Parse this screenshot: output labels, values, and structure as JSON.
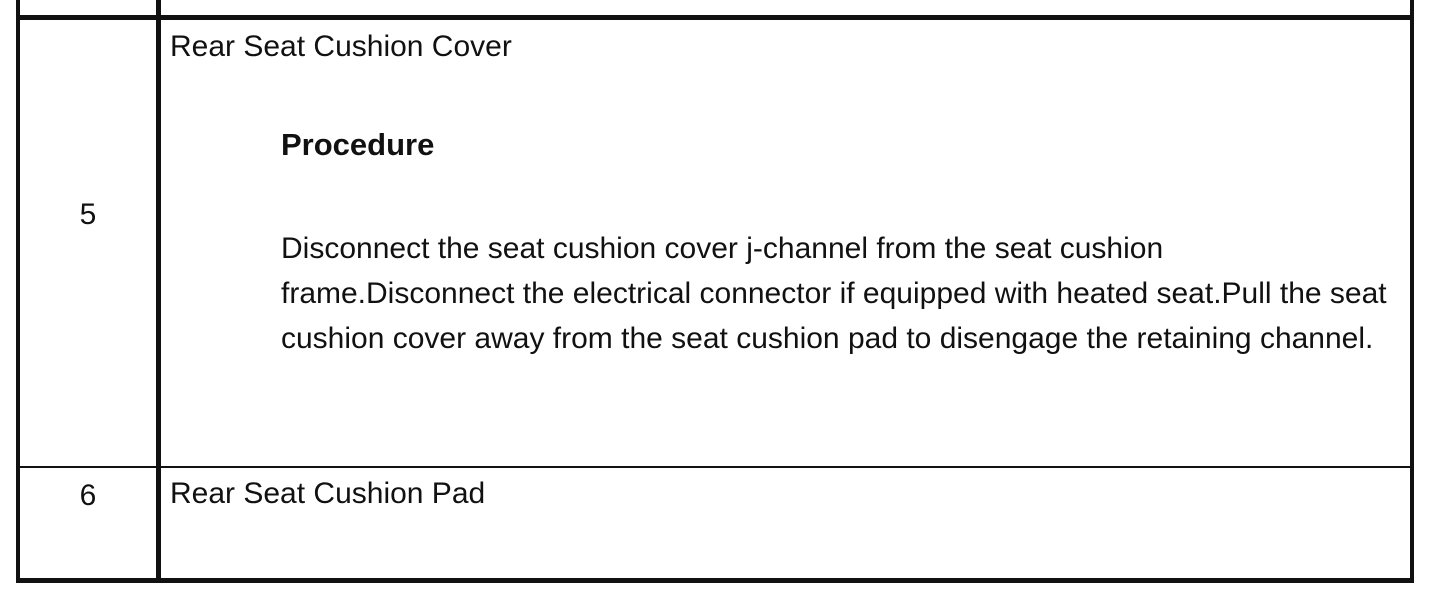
{
  "rows": [
    {
      "number": "5",
      "title": "Rear Seat Cushion Cover",
      "heading": "Procedure",
      "text": "Disconnect the seat cushion cover j-channel from the seat cushion frame.Disconnect the electrical connector if equipped with heated seat.Pull the seat cushion cover away from the seat cushion pad to disengage the retaining channel."
    },
    {
      "number": "6",
      "title": "Rear Seat Cushion Pad"
    }
  ]
}
